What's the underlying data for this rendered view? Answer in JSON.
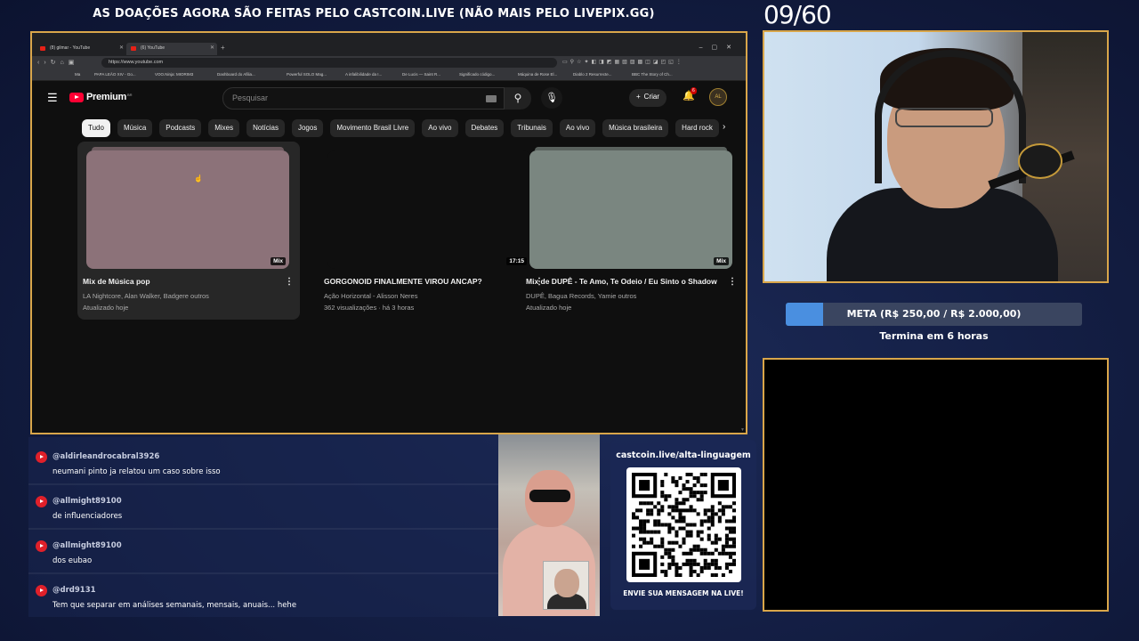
{
  "overlay": {
    "banner": "AS DOAÇÕES AGORA SÃO FEITAS PELO CASTCOIN.LIVE (NÃO MAIS PELO LIVEPIX.GG)",
    "counter": "09/60",
    "meta_label": "META (R$ 250,00 / R$ 2.000,00)",
    "meta_progress": 0.125,
    "termina": "Termina em 6 horas",
    "accent_color": "#d9a64a",
    "progress_color": "#4a8fe0"
  },
  "browser": {
    "tabs": [
      {
        "label": "(8) gilmar - YouTube",
        "active": false
      },
      {
        "label": "(6) YouTube",
        "active": true
      }
    ],
    "url": "https://www.youtube.com",
    "bookmarks": [
      "Ma",
      "PAPA LEÃO XIV - Go...",
      "VOO.Ninja: MIORIM3",
      "Dashboard do Afilia...",
      "Powerful SOLO Mag...",
      "A infalibilidade da I...",
      "De Lucis — Saint R...",
      "Significado código...",
      "Máquina de Rose El...",
      "Diablo 2 Resurrecte...",
      "BBC The Story of Ch..."
    ]
  },
  "youtube": {
    "brand": "Premium",
    "brand_region": "BR",
    "search_placeholder": "Pesquisar",
    "criar_label": "Criar",
    "notifications_count": "6",
    "avatar_label": "AL",
    "chips": [
      "Tudo",
      "Música",
      "Podcasts",
      "Mixes",
      "Notícias",
      "Jogos",
      "Movimento Brasil Livre",
      "Ao vivo",
      "Debates",
      "Tribunais",
      "Ao vivo",
      "Música brasileira",
      "Hard rock"
    ],
    "cards": [
      {
        "title": "Mix de Música pop",
        "line1": "LA Nightcore, Alan Walker, Badgere outros",
        "line2": "Atualizado hoje",
        "badge": "Mix",
        "color": "#8c7279",
        "hover": true
      },
      {
        "title": "GORGONOID FINALMENTE VIROU ANCAP?",
        "line1": "Ação Horizontal - Alisson Neres",
        "line2": "362 visualizações · há 3 horas",
        "badge": "17:15",
        "color": "#0f0f0f",
        "hover": false
      },
      {
        "title": "Mix de DUPÊ - Te Amo, Te Odeio / Eu Sinto o Shadow",
        "line1": "DUPÊ, Bagua Records, Yamie outros",
        "line2": "Atualizado hoje",
        "badge": "Mix",
        "color": "#7a8680",
        "hover": false
      }
    ]
  },
  "chat": {
    "messages": [
      {
        "user": "@aldirleandrocabral3926",
        "text": "neumani pinto ja relatou um caso sobre isso"
      },
      {
        "user": "@allmight89100",
        "text": "de influenciadores"
      },
      {
        "user": "@allmight89100",
        "text": "dos eubao"
      },
      {
        "user": "@drd9131",
        "text": "Tem que separar em análises semanais, mensais, anuais... hehe"
      }
    ]
  },
  "qr": {
    "title": "castcoin.live/alta-linguagem",
    "bottom": "ENVIE SUA MENSAGEM NA LIVE!"
  }
}
